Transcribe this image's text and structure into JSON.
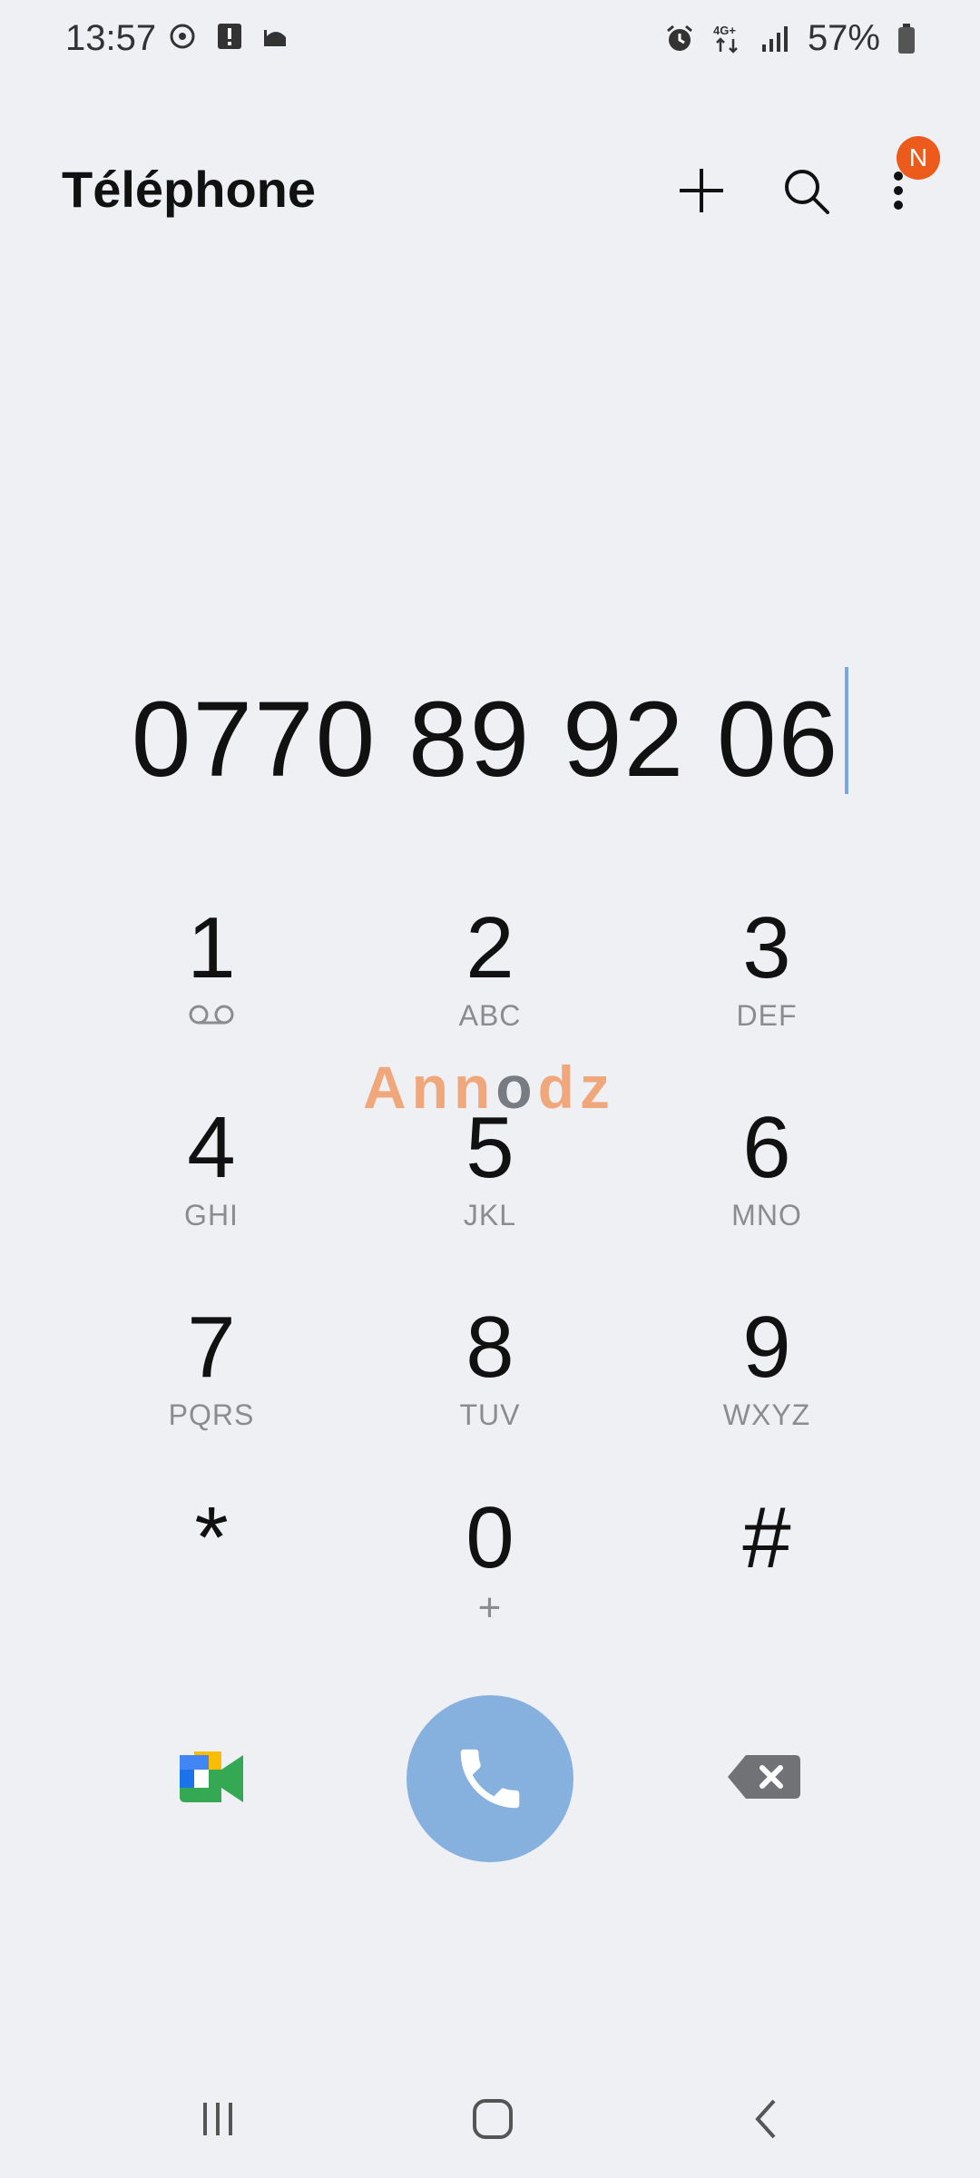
{
  "status_bar": {
    "time": "13:57",
    "network": "4G+",
    "battery": "57%",
    "icons_left": [
      "sync-icon",
      "alert-icon",
      "mosque-icon"
    ],
    "icons_right": [
      "alarm-icon",
      "network-4g-icon",
      "signal-icon",
      "battery-icon"
    ]
  },
  "header": {
    "title": "Téléphone",
    "badge": "N",
    "actions": [
      "add-icon",
      "search-icon",
      "more-vert-icon"
    ]
  },
  "dialed_number": "0770 89 92 06",
  "keypad": [
    {
      "digit": "1",
      "letters": ""
    },
    {
      "digit": "2",
      "letters": "ABC"
    },
    {
      "digit": "3",
      "letters": "DEF"
    },
    {
      "digit": "4",
      "letters": "GHI"
    },
    {
      "digit": "5",
      "letters": "JKL"
    },
    {
      "digit": "6",
      "letters": "MNO"
    },
    {
      "digit": "7",
      "letters": "PQRS"
    },
    {
      "digit": "8",
      "letters": "TUV"
    },
    {
      "digit": "9",
      "letters": "WXYZ"
    },
    {
      "digit": "*",
      "letters": ""
    },
    {
      "digit": "0",
      "letters": "+"
    },
    {
      "digit": "#",
      "letters": ""
    }
  ],
  "watermark": {
    "part1": "Ann",
    "part2": "o",
    "part3": "dz"
  },
  "colors": {
    "background": "#eef0f4",
    "accent_call": "#86b0dd",
    "badge": "#ec5b1c",
    "caret": "#7aa7dc"
  }
}
